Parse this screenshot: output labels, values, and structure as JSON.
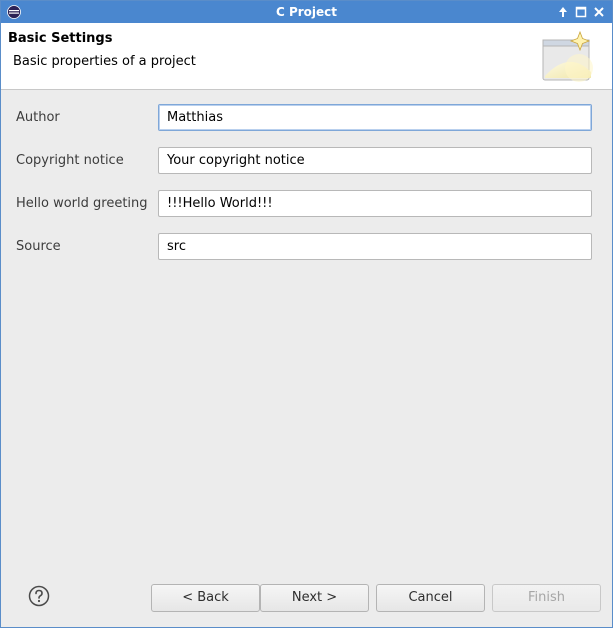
{
  "window": {
    "title": "C Project"
  },
  "banner": {
    "title": "Basic Settings",
    "subtitle": "Basic properties of a project"
  },
  "form": {
    "fields": [
      {
        "label": "Author",
        "value": "Matthias"
      },
      {
        "label": "Copyright notice",
        "value": "Your copyright notice"
      },
      {
        "label": "Hello world greeting",
        "value": "!!!Hello World!!!"
      },
      {
        "label": "Source",
        "value": "src"
      }
    ]
  },
  "buttons": {
    "back": "< Back",
    "next": "Next >",
    "cancel": "Cancel",
    "finish": "Finish"
  },
  "icons": {
    "app": "eclipse-icon",
    "minimize": "arrow-up-icon",
    "maximize": "maximize-icon",
    "close": "close-icon",
    "help": "help-icon",
    "wizard": "wizard-banner-icon"
  },
  "colors": {
    "titlebar": "#4a87cf",
    "background": "#ececec",
    "focus_border": "#7fa7d8"
  }
}
